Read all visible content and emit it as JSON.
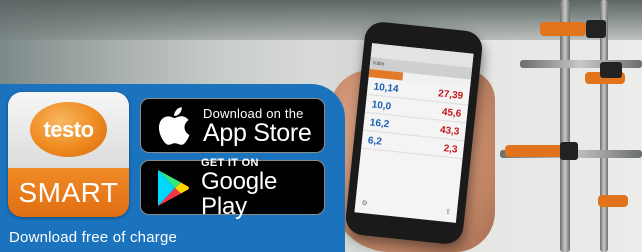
{
  "brand": {
    "logo_text": "testo",
    "product_text": "SMART",
    "accent_orange": "#ee8a20",
    "panel_blue": "#1b72bd"
  },
  "stores": {
    "apple": {
      "small_label": "Download on the",
      "big_label": "App Store",
      "icon": "apple-icon"
    },
    "google": {
      "small_label": "GET IT ON",
      "big_label": "Google Play",
      "icon": "google-play-icon"
    }
  },
  "caption": "Download free of charge",
  "phone_app": {
    "title": "Kälte",
    "rows": [
      {
        "left": "10,14",
        "right": "27,39"
      },
      {
        "left": "10,0",
        "right": "45,6"
      },
      {
        "left": "16,2",
        "right": "43,3"
      },
      {
        "left": "6,2",
        "right": "2,3"
      }
    ]
  }
}
